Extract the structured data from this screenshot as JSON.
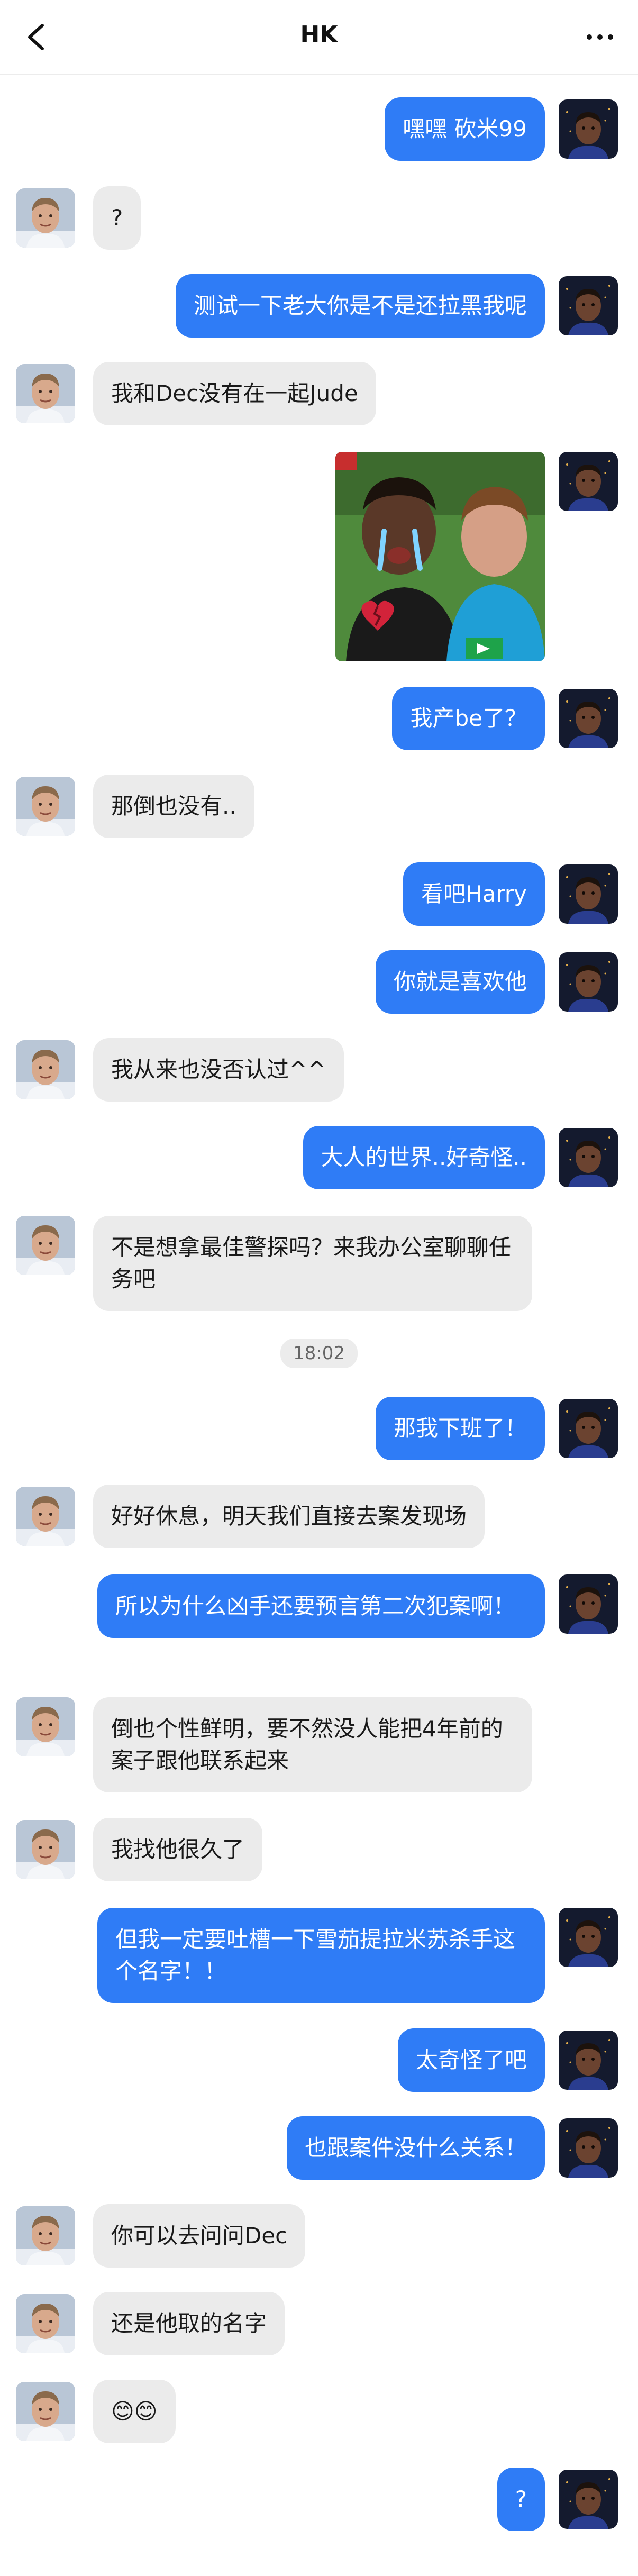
{
  "header": {
    "title": "HK",
    "back_icon": "chevron-left-icon",
    "more_icon": "ellipsis-icon"
  },
  "colors": {
    "outgoing_bubble": "#2f7cf6",
    "incoming_bubble": "#ebebeb"
  },
  "messages": [
    {
      "from": "me",
      "text": "嘿嘿 砍米99"
    },
    {
      "from": "them",
      "text": "?"
    },
    {
      "from": "me",
      "text": "测试一下老大你是不是还拉黑我呢"
    },
    {
      "from": "them",
      "text": "我和Dec没有在一起Jude"
    },
    {
      "from": "me",
      "type": "image",
      "description": "sticker-photo"
    },
    {
      "from": "me",
      "text": "我产be了？"
    },
    {
      "from": "them",
      "text": "那倒也没有.."
    },
    {
      "from": "me",
      "text": "看吧Harry"
    },
    {
      "from": "me",
      "text": "你就是喜欢他"
    },
    {
      "from": "them",
      "text": "我从来也没否认过^^"
    },
    {
      "from": "me",
      "text": "大人的世界..好奇怪.."
    },
    {
      "from": "them",
      "text": "不是想拿最佳警探吗？来我办公室聊聊任务吧"
    },
    {
      "type": "timestamp",
      "text": "18:02"
    },
    {
      "from": "me",
      "text": "那我下班了！"
    },
    {
      "from": "them",
      "text": "好好休息，明天我们直接去案发现场"
    },
    {
      "from": "me",
      "text": "所以为什么凶手还要预言第二次犯案啊！"
    },
    {
      "from": "them",
      "text": "倒也个性鲜明，要不然没人能把4年前的案子跟他联系起来"
    },
    {
      "from": "them",
      "text": "我找他很久了"
    },
    {
      "from": "me",
      "text": "但我一定要吐槽一下雪茄提拉米苏杀手这个名字！！"
    },
    {
      "from": "me",
      "text": "太奇怪了吧"
    },
    {
      "from": "me",
      "text": "也跟案件没什么关系！"
    },
    {
      "from": "them",
      "text": "你可以去问问Dec"
    },
    {
      "from": "them",
      "text": "还是他取的名字"
    },
    {
      "from": "them",
      "text": "😊😊"
    },
    {
      "from": "me",
      "text": "?"
    }
  ]
}
